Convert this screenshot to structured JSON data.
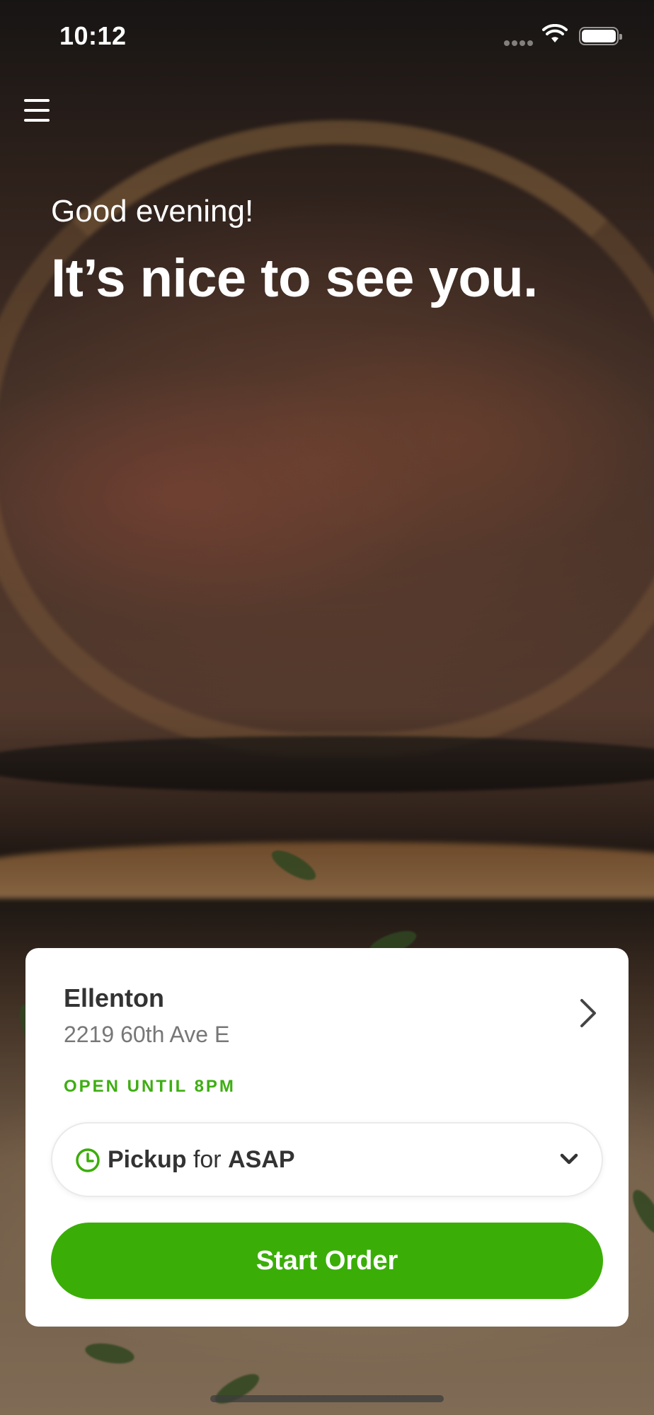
{
  "status_bar": {
    "time": "10:12"
  },
  "hero": {
    "greeting": "Good evening!",
    "headline": "It’s nice to see you."
  },
  "location": {
    "name": "Ellenton",
    "address": "2219 60th Ave E",
    "open_status": "OPEN UNTIL 8PM"
  },
  "pickup": {
    "mode": "Pickup",
    "connector": "for",
    "time": "ASAP"
  },
  "actions": {
    "start_order": "Start Order"
  },
  "colors": {
    "accent": "#3aae07",
    "open_status": "#3eae12"
  },
  "icons": [
    "menu-icon",
    "chevron-right-icon",
    "clock-icon",
    "chevron-down-icon",
    "wifi-icon",
    "battery-icon",
    "signal-icon"
  ]
}
